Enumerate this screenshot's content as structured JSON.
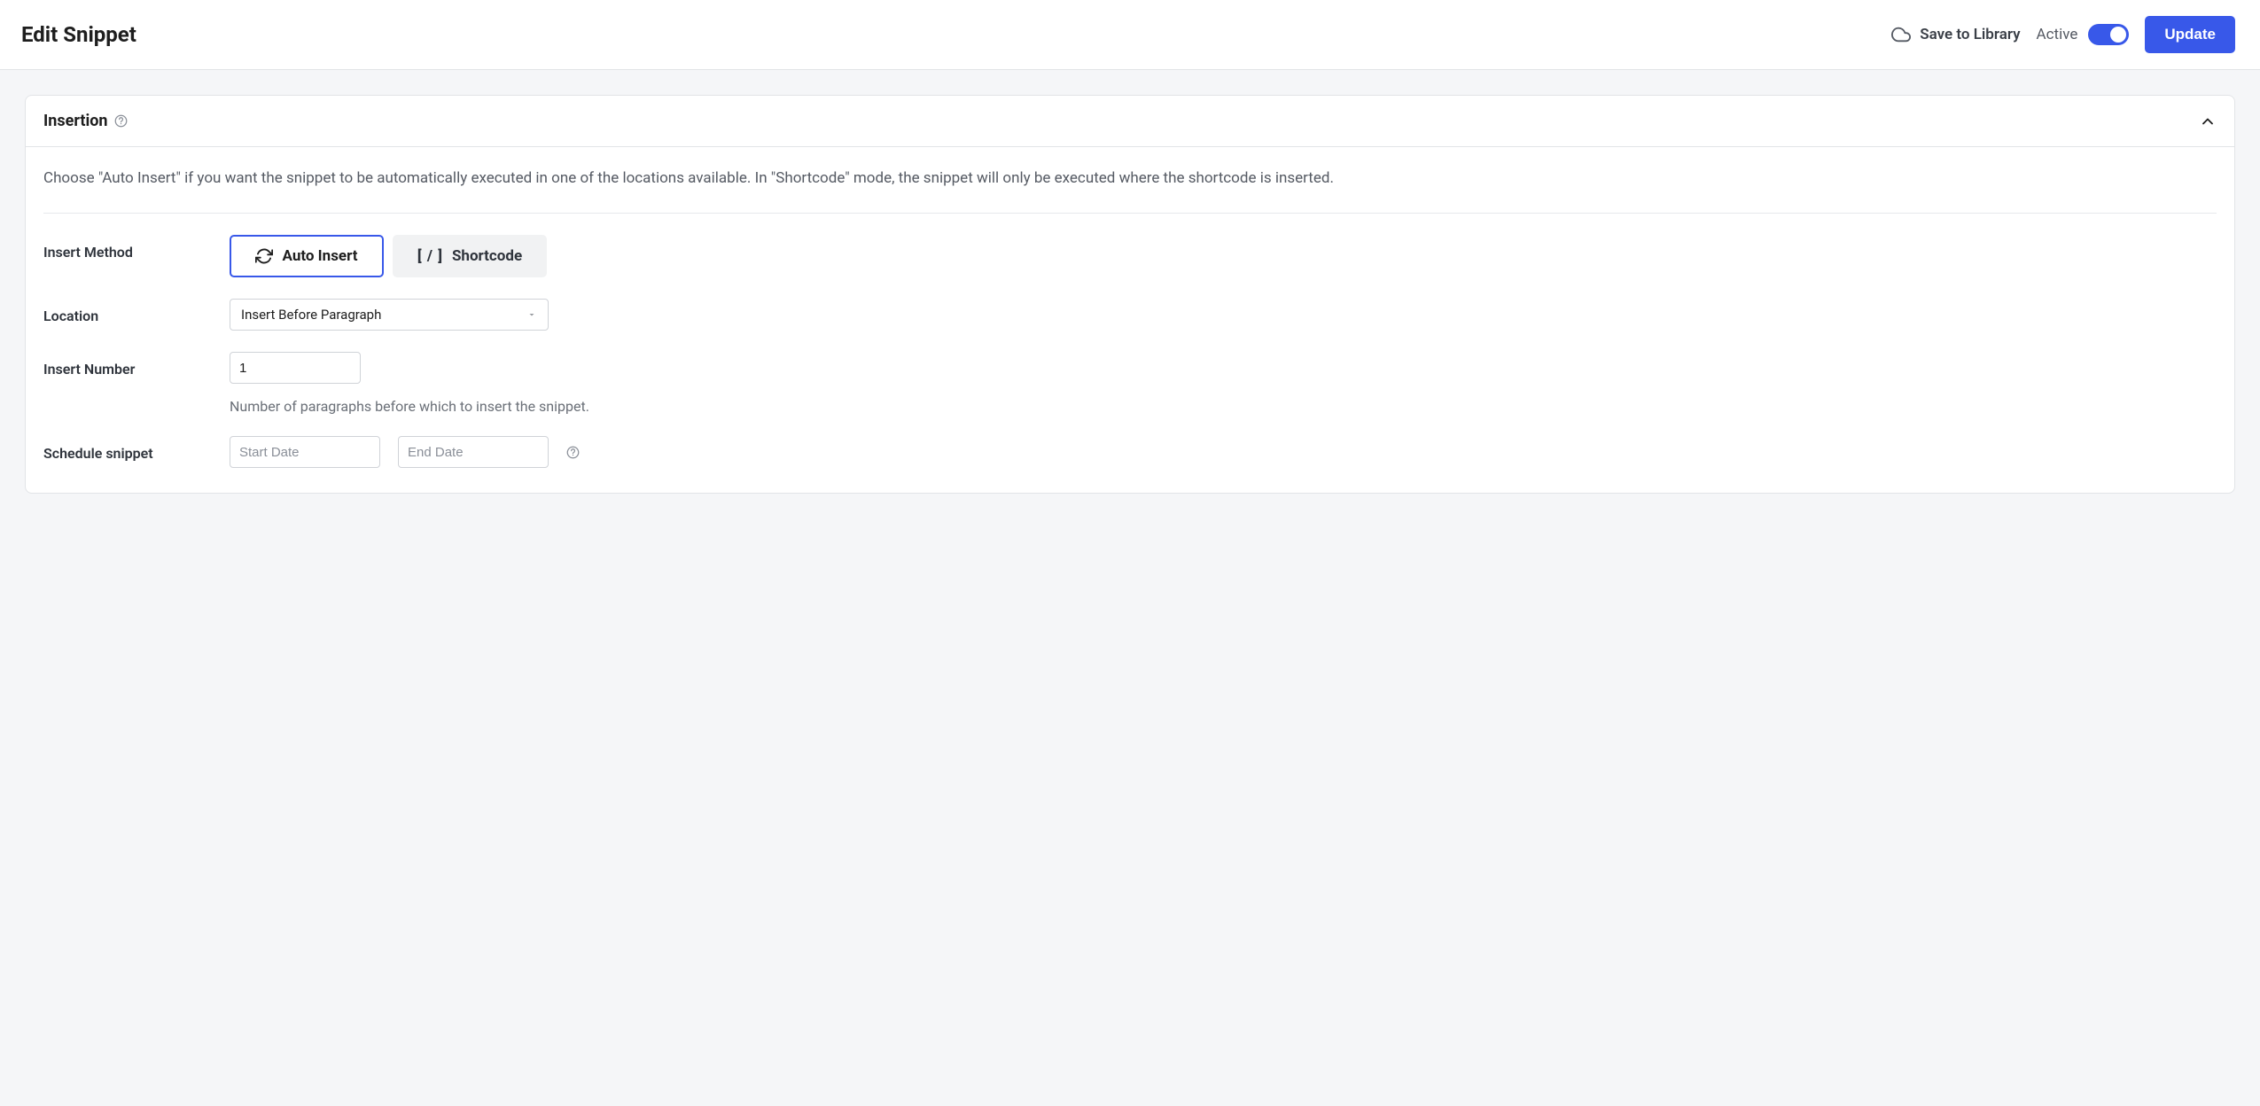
{
  "header": {
    "title": "Edit Snippet",
    "save_to_library": "Save to Library",
    "active_label": "Active",
    "update": "Update"
  },
  "panel": {
    "title": "Insertion",
    "description": "Choose \"Auto Insert\" if you want the snippet to be automatically executed in one of the locations available. In \"Shortcode\" mode, the snippet will only be executed where the shortcode is inserted."
  },
  "fields": {
    "insert_method": {
      "label": "Insert Method",
      "auto_insert": "Auto Insert",
      "shortcode": "Shortcode"
    },
    "location": {
      "label": "Location",
      "value": "Insert Before Paragraph"
    },
    "insert_number": {
      "label": "Insert Number",
      "value": "1",
      "help": "Number of paragraphs before which to insert the snippet."
    },
    "schedule": {
      "label": "Schedule snippet",
      "start_placeholder": "Start Date",
      "end_placeholder": "End Date"
    }
  }
}
